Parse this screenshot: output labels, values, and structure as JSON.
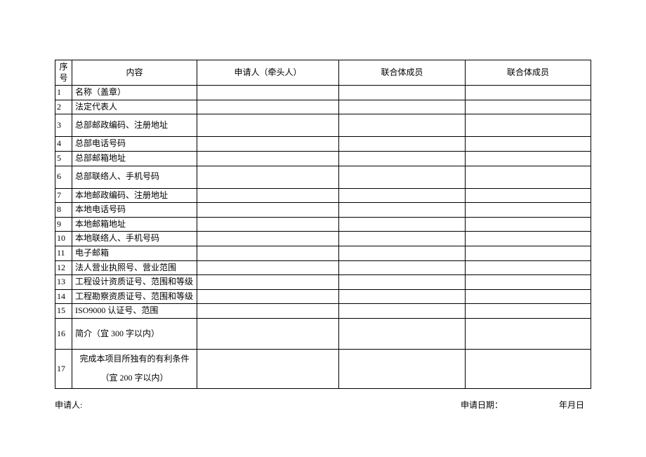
{
  "headers": {
    "seq": "序号",
    "content": "内容",
    "applicant": "申请人（牵头人）",
    "member1": "联合体成员",
    "member2": "联合体成员"
  },
  "rows": [
    {
      "seq": "1",
      "content": "名称（盖章）"
    },
    {
      "seq": "2",
      "content": "法定代表人"
    },
    {
      "seq": "3",
      "content": "总部邮政编码、注册地址"
    },
    {
      "seq": "4",
      "content": "总部电话号码"
    },
    {
      "seq": "5",
      "content": "总部邮箱地址"
    },
    {
      "seq": "6",
      "content": "总部联络人、手机号码"
    },
    {
      "seq": "7",
      "content": "本地邮政编码、注册地址"
    },
    {
      "seq": "8",
      "content": "本地电话号码"
    },
    {
      "seq": "9",
      "content": "本地邮箱地址"
    },
    {
      "seq": "10",
      "content": "本地联络人、手机号码"
    },
    {
      "seq": "11",
      "content": "电子邮箱"
    },
    {
      "seq": "12",
      "content": "法人营业执照号、营业范围"
    },
    {
      "seq": "13",
      "content": "工程设计资质证号、范围和等级"
    },
    {
      "seq": "14",
      "content": "工程勘察资质证号、范围和等级"
    },
    {
      "seq": "15",
      "content": "ISO9000 认证号、范围"
    },
    {
      "seq": "16",
      "content": "简介（宜 300 字以内）"
    },
    {
      "seq": "17",
      "content_line1": "完成本项目所独有的有利条件",
      "content_line2": "（宜 200 字以内）"
    }
  ],
  "footer": {
    "applicant_label": "申请人:",
    "date_label": "申请日期：",
    "date_value": "年月日"
  }
}
